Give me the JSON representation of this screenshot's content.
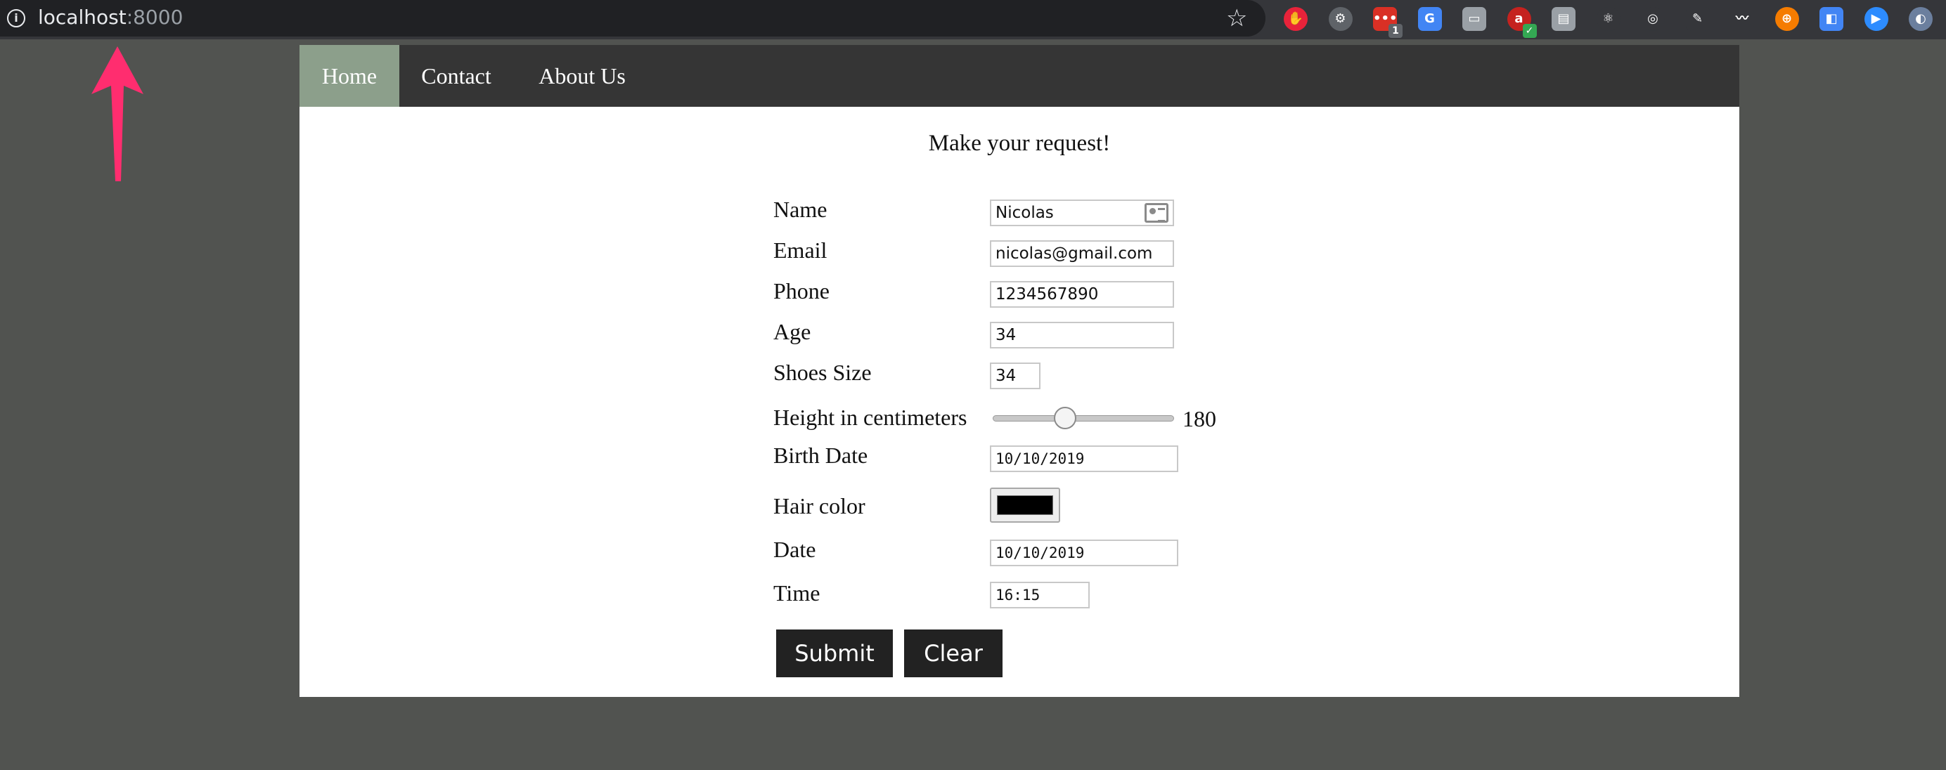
{
  "browser": {
    "url_host": "localhost",
    "url_port": ":8000",
    "extensions": [
      {
        "name": "adblock-icon",
        "color": "#e8233a",
        "glyph": "✋",
        "round": true
      },
      {
        "name": "settings-gear-icon",
        "color": "#5f6368",
        "glyph": "⚙",
        "round": true
      },
      {
        "name": "extension-dots-icon",
        "color": "#d93025",
        "glyph": "•••",
        "badge": "1",
        "badge_color": "#5f6368"
      },
      {
        "name": "google-translate-icon",
        "color": "#4285f4",
        "glyph": "G"
      },
      {
        "name": "window-icon",
        "color": "#9aa0a6",
        "glyph": "▭"
      },
      {
        "name": "grammar-check-icon",
        "color": "#c5221f",
        "glyph": "a",
        "round": true,
        "badge": "✓",
        "badge_color": "#34a853"
      },
      {
        "name": "briefcase-icon",
        "color": "#9aa0a6",
        "glyph": "▤"
      },
      {
        "name": "react-devtools-icon",
        "color": "#35363a",
        "glyph": "⚛",
        "round": true
      },
      {
        "name": "target-icon",
        "color": "#35363a",
        "glyph": "◎",
        "round": true
      },
      {
        "name": "feather-icon",
        "color": "#35363a",
        "glyph": "✎"
      },
      {
        "name": "wave-icon",
        "color": "#35363a",
        "glyph": "〰"
      },
      {
        "name": "lifebuoy-icon",
        "color": "#f57c00",
        "glyph": "⊕",
        "round": true
      },
      {
        "name": "bluetooth-window-icon",
        "color": "#4285f4",
        "glyph": "◧"
      },
      {
        "name": "zoom-video-icon",
        "color": "#2d8cff",
        "glyph": "▶",
        "round": true
      },
      {
        "name": "profile-icon",
        "color": "#6b7f9e",
        "glyph": "◐",
        "round": true
      }
    ]
  },
  "nav": {
    "items": [
      "Home",
      "Contact",
      "About Us"
    ],
    "active_color": "#8c9f8b"
  },
  "form": {
    "heading": "Make your request!",
    "labels": {
      "name": "Name",
      "email": "Email",
      "phone": "Phone",
      "age": "Age",
      "shoes": "Shoes Size",
      "height": "Height in centimeters",
      "birth": "Birth Date",
      "hair": "Hair color",
      "date": "Date",
      "time": "Time"
    },
    "values": {
      "name": "Nicolas",
      "email": "nicolas@gmail.com",
      "phone": "1234567890",
      "age": "34",
      "shoes": "34",
      "height": "180",
      "height_fraction": 0.4,
      "birth": "10/10/2019",
      "hair": "#000000",
      "date": "10/10/2019",
      "time": "16:15"
    },
    "buttons": {
      "submit": "Submit",
      "clear": "Clear"
    }
  },
  "annotation": {
    "arrow_color": "#ff2d6f"
  }
}
